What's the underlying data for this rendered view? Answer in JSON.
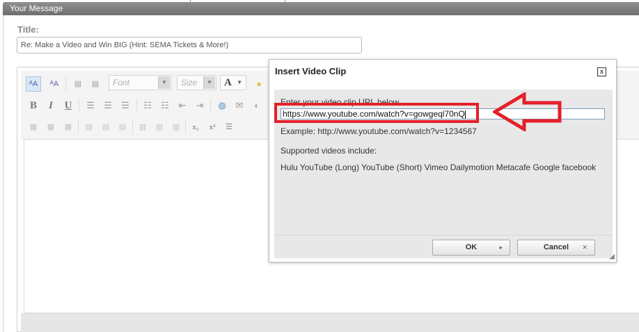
{
  "panel": {
    "header": "Your Message"
  },
  "form": {
    "title_label": "Title:",
    "title_value": "Re: Make a Video and Win BIG (Hint: SEMA Tickets & More!)"
  },
  "toolbar": {
    "font_combo": "Font",
    "size_combo": "Size",
    "font_color_label": "A",
    "bold": "B",
    "italic": "I",
    "underline": "U",
    "subscript": "x₂",
    "superscript": "x²"
  },
  "dialog": {
    "title": "Insert Video Clip",
    "close": "x",
    "prompt": "Enter your video clip URL below",
    "url_value": "https://www.youtube.com/watch?v=gowgeql70nQ",
    "example": "Example: http://www.youtube.com/watch?v=1234567",
    "supported_heading": "Supported videos include:",
    "supported_list": "Hulu YouTube (Long) YouTube (Short) Vimeo Dailymotion Metacafe Google facebook",
    "ok_label": "OK",
    "cancel_label": "Cancel"
  },
  "annotation": {
    "color": "#e3202b"
  }
}
